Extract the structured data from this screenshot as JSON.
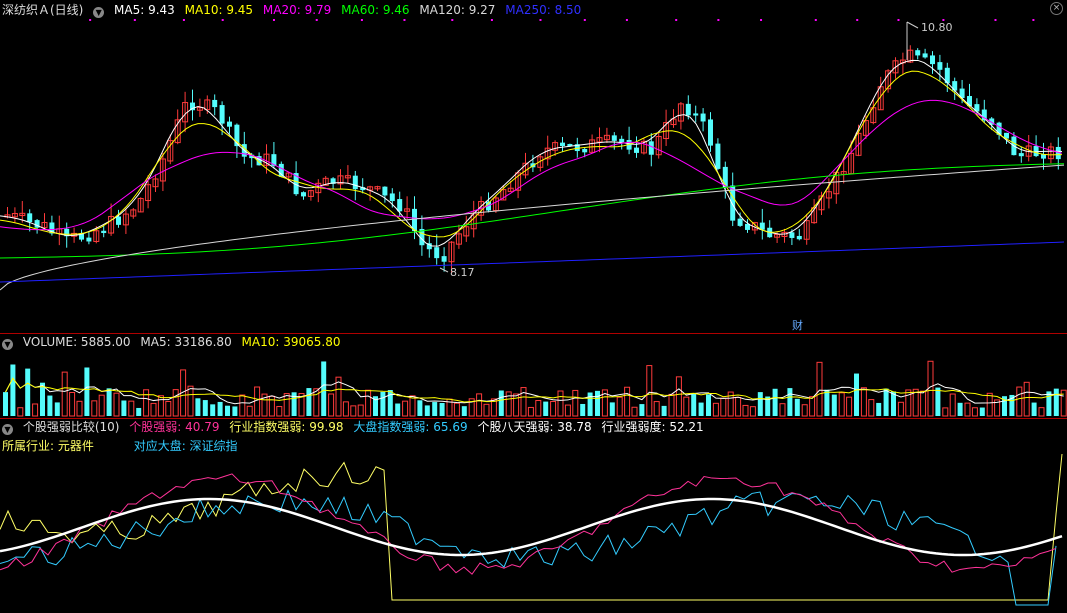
{
  "price_panel": {
    "title": "深纺织Ａ(日线)",
    "ma": [
      {
        "label": "MA5: 9.43",
        "color": "#ffffff"
      },
      {
        "label": "MA10: 9.45",
        "color": "#ffff00"
      },
      {
        "label": "MA20: 9.79",
        "color": "#ff00ff"
      },
      {
        "label": "MA60: 9.46",
        "color": "#00ff00"
      },
      {
        "label": "MA120: 9.27",
        "color": "#d8d8d8"
      },
      {
        "label": "MA250: 8.50",
        "color": "#2020ff"
      }
    ],
    "high_label": "10.80",
    "low_label": "8.17",
    "finance_marker": "财"
  },
  "volume_panel": {
    "items": [
      {
        "label": "VOLUME: 5885.00",
        "color": "#dddddd"
      },
      {
        "label": "MA5: 33186.80",
        "color": "#dddddd"
      },
      {
        "label": "MA10: 39065.80",
        "color": "#ffff00"
      }
    ]
  },
  "strength_panel": {
    "title": "个股强弱比较(10)",
    "items": [
      {
        "label": "个股强弱: 40.79",
        "color": "#ff3399"
      },
      {
        "label": "行业指数强弱: 99.98",
        "color": "#ffff66"
      },
      {
        "label": "大盘指数强弱: 65.69",
        "color": "#33ccff"
      },
      {
        "label": "个股八天强弱: 38.78",
        "color": "#ffffff"
      },
      {
        "label": "行业强弱度: 52.21",
        "color": "#ffffff"
      }
    ],
    "industry_label": "所属行业: 元器件",
    "market_label": "对应大盘: 深证综指"
  },
  "colors": {
    "up": "#ff3b3b",
    "down": "#54fcfc",
    "separator": "#b00000"
  },
  "icons": {
    "dropdown": "chevron-down-icon",
    "close": "close-icon"
  }
}
